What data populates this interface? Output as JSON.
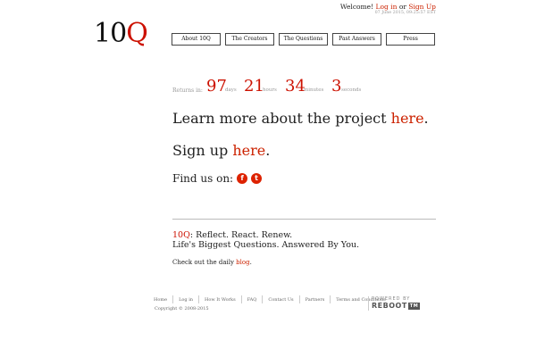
{
  "header": {
    "welcome_text": "Welcome!",
    "login_link": "Log in",
    "or_text": "or",
    "signup_link": "Sign Up",
    "datetime": "07 June 2015, 09:25:57 EST"
  },
  "logo": {
    "number": "10",
    "letter": "Q"
  },
  "nav": {
    "items": [
      {
        "label": "About 10Q"
      },
      {
        "label": "The Creators"
      },
      {
        "label": "The Questions"
      },
      {
        "label": "Past Answers"
      },
      {
        "label": "Press"
      }
    ]
  },
  "countdown": {
    "label": "Returns in:",
    "days": "97",
    "days_unit": "days",
    "hours": "21",
    "hours_unit": "hours",
    "minutes": "34",
    "minutes_unit": "minutes",
    "seconds": "3",
    "seconds_unit": "seconds"
  },
  "learn": {
    "text": "Learn more about the project",
    "link": "here",
    "end": "."
  },
  "signup": {
    "text": "Sign up",
    "link": "here",
    "end": "."
  },
  "find": {
    "text": "Find us on:",
    "facebook": "f",
    "twitter": "t"
  },
  "tagline": {
    "brand": "10Q",
    "line1_rest": ": Reflect. React. Renew.",
    "line2": "Life's Biggest Questions. Answered By You."
  },
  "blog": {
    "text": "Check out the daily",
    "link": "blog",
    "end": "."
  },
  "footer": {
    "links": [
      "Home",
      "Log in",
      "How It Works",
      "FAQ",
      "Contact Us",
      "Partners",
      "Terms and Conditions"
    ],
    "powered_by": "POWERED BY",
    "powered_brand": "REBOOT",
    "powered_box": "TM",
    "copyright": "Copyright © 2008-2015"
  },
  "colors": {
    "accent": "#cc1100",
    "text": "#222222",
    "muted": "#999999"
  }
}
